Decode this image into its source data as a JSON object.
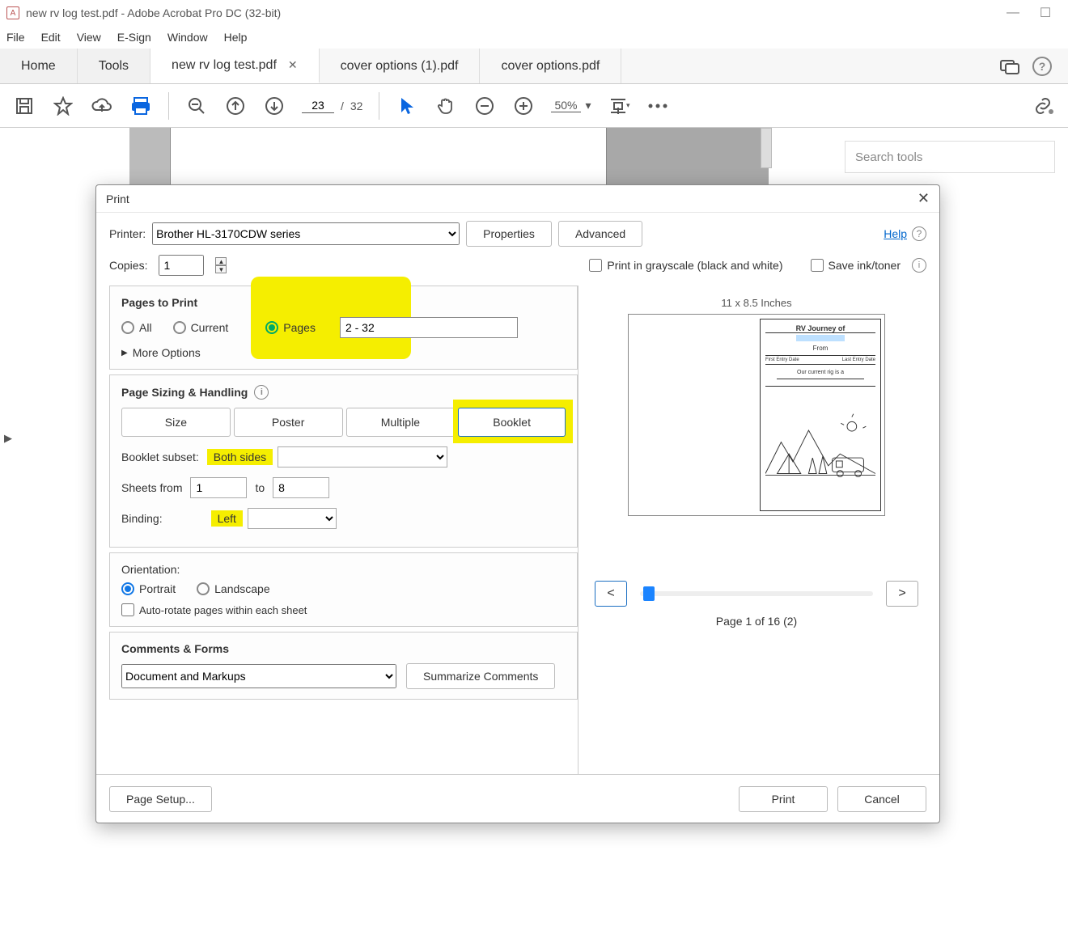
{
  "window": {
    "title": "new rv log test.pdf - Adobe Acrobat Pro DC (32-bit)"
  },
  "menubar": [
    "File",
    "Edit",
    "View",
    "E-Sign",
    "Window",
    "Help"
  ],
  "home": "Home",
  "tools": "Tools",
  "tabs": [
    {
      "label": "new rv log test.pdf",
      "active": true,
      "closable": true
    },
    {
      "label": "cover options (1).pdf",
      "active": false,
      "closable": false
    },
    {
      "label": "cover options.pdf",
      "active": false,
      "closable": false
    }
  ],
  "toolbar": {
    "page_current": "23",
    "page_total": "32",
    "zoom": "50%"
  },
  "search_tools_placeholder": "Search tools",
  "print": {
    "title": "Print",
    "printer_label": "Printer:",
    "printer_value": "Brother HL-3170CDW series",
    "properties": "Properties",
    "advanced": "Advanced",
    "help": "Help",
    "copies_label": "Copies:",
    "copies_value": "1",
    "grayscale": "Print in grayscale (black and white)",
    "saveink": "Save ink/toner",
    "pages_to_print": "Pages to Print",
    "all": "All",
    "current": "Current",
    "pages": "Pages",
    "page_range": "2 - 32",
    "more_options": "More Options",
    "sizing_title": "Page Sizing & Handling",
    "size_btn": "Size",
    "poster_btn": "Poster",
    "multiple_btn": "Multiple",
    "booklet_btn": "Booklet",
    "booklet_subset_label": "Booklet subset:",
    "booklet_subset_value": "Both sides",
    "sheets_from_label": "Sheets from",
    "sheets_from": "1",
    "sheets_to_label": "to",
    "sheets_to": "8",
    "binding_label": "Binding:",
    "binding_value": "Left",
    "orientation_title": "Orientation:",
    "portrait": "Portrait",
    "landscape": "Landscape",
    "autorotate": "Auto-rotate pages within each sheet",
    "comments_title": "Comments & Forms",
    "comments_value": "Document and Markups",
    "summarize": "Summarize Comments",
    "preview": {
      "dims": "11 x 8.5 Inches",
      "rv_journey": "RV Journey of",
      "from": "From",
      "first_entry": "First Entry Date",
      "last_entry": "Last Entry Date",
      "current_rig": "Our current rig is a",
      "page_label": "Page 1 of 16 (2)",
      "prev": "<",
      "next": ">"
    },
    "page_setup": "Page Setup...",
    "do_print": "Print",
    "cancel": "Cancel"
  }
}
